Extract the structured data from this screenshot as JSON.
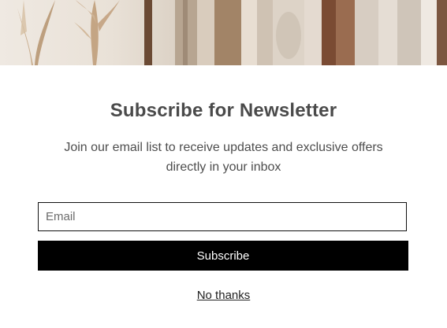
{
  "hero": {
    "image_name": "hero-clothing-rack-image"
  },
  "newsletter": {
    "title": "Subscribe for Newsletter",
    "description": "Join our email list to receive updates and exclusive offers directly in your inbox",
    "email": {
      "placeholder": "Email",
      "value": ""
    },
    "subscribe_label": "Subscribe",
    "dismiss_label": "No thanks"
  },
  "colors": {
    "button_background": "#000000",
    "button_text": "#ffffff",
    "title_text": "#4a4a4a",
    "field_border": "#111111"
  }
}
